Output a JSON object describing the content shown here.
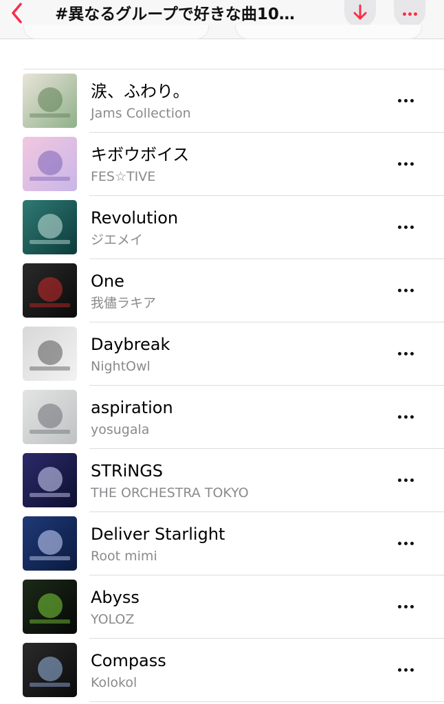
{
  "header": {
    "title": "#異なるグループで好きな曲10…",
    "back_icon": "chevron-left-icon",
    "download_icon": "arrow-down-icon",
    "more_icon": "ellipsis-icon",
    "accent_color": "#fa2d48"
  },
  "tracks": [
    {
      "title": "涙、ふわり。",
      "artist": "Jams Collection",
      "art_colors": [
        "#8fb08a",
        "#e9e4d8",
        "#5e7f55"
      ]
    },
    {
      "title": "キボウボイス",
      "artist": "FES☆TIVE",
      "art_colors": [
        "#c9b6e8",
        "#f2c7df",
        "#7b63b8"
      ]
    },
    {
      "title": "Revolution",
      "artist": "ジエメイ",
      "art_colors": [
        "#0c3b3b",
        "#2f7a73",
        "#c9e6e0"
      ]
    },
    {
      "title": "One",
      "artist": "我儘ラキア",
      "art_colors": [
        "#0a0a0a",
        "#2a2a2a",
        "#d02a2a"
      ]
    },
    {
      "title": "Daybreak",
      "artist": "NightOwl",
      "art_colors": [
        "#f2f2f2",
        "#d8d8d8",
        "#555555"
      ]
    },
    {
      "title": "aspiration",
      "artist": "yosugala",
      "art_colors": [
        "#bfc2c3",
        "#e3e4e4",
        "#6b6f72"
      ]
    },
    {
      "title": "STRiNGS",
      "artist": "THE ORCHESTRA TOKYO",
      "art_colors": [
        "#0d1030",
        "#2c2a6a",
        "#d9d9ff"
      ]
    },
    {
      "title": "Deliver Starlight",
      "artist": "Root mimi",
      "art_colors": [
        "#0b1a3f",
        "#1f3a78",
        "#cfd9ff"
      ]
    },
    {
      "title": "Abyss",
      "artist": "YOLOZ",
      "art_colors": [
        "#060806",
        "#1c2a18",
        "#7cd13a"
      ]
    },
    {
      "title": "Compass",
      "artist": "Kolokol",
      "art_colors": [
        "#0b0b0b",
        "#2a2a2a",
        "#9bb9e8"
      ]
    }
  ]
}
